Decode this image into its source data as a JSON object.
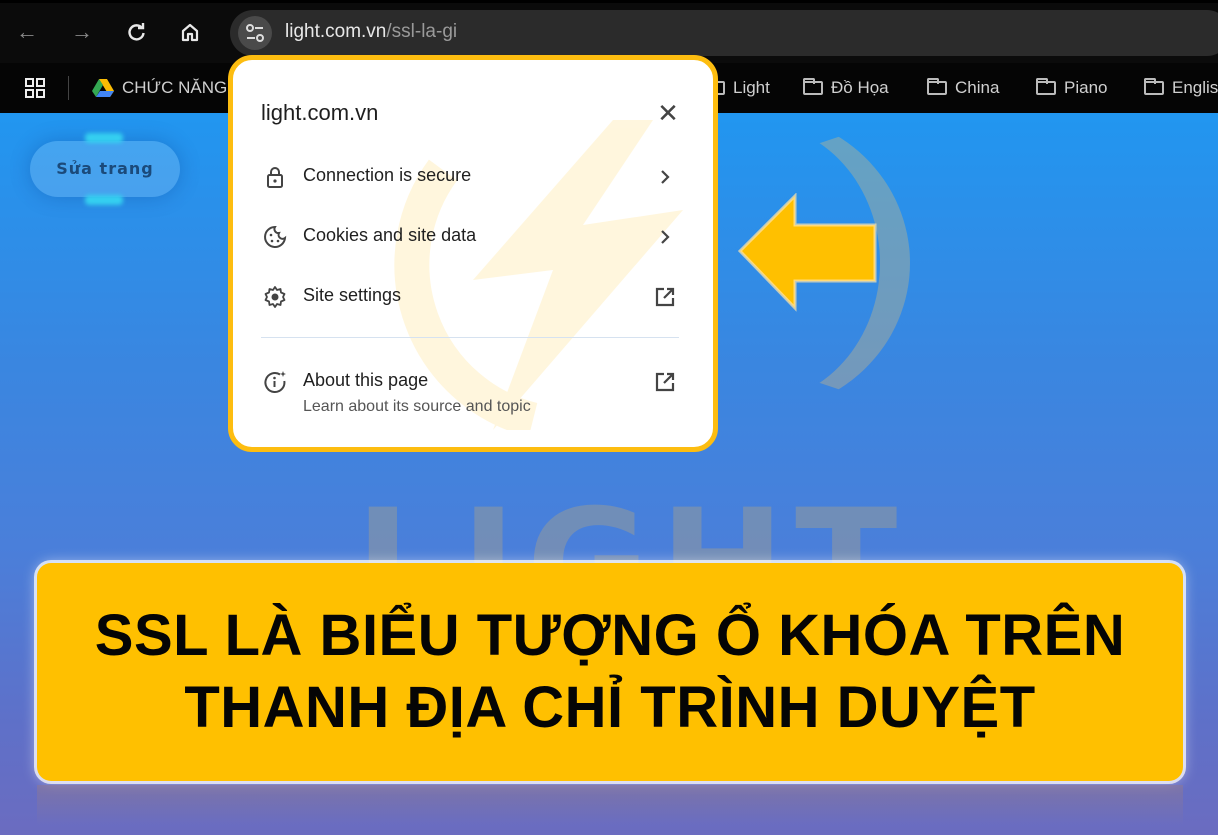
{
  "browser": {
    "nav": {
      "back_icon": "arrow-left-icon",
      "forward_icon": "arrow-right-icon",
      "reload_icon": "reload-icon",
      "home_icon": "home-icon"
    },
    "omnibox": {
      "site_info_icon": "tune-icon",
      "domain": "light.com.vn",
      "path": "/ssl-la-gi"
    },
    "bookmarks": [
      {
        "label": "CHỨC NĂNG",
        "icon": "google-drive-icon"
      },
      {
        "label": "Light",
        "icon": "folder-icon"
      },
      {
        "label": "Đồ Họa",
        "icon": "folder-icon"
      },
      {
        "label": "China",
        "icon": "folder-icon"
      },
      {
        "label": "Piano",
        "icon": "folder-icon"
      },
      {
        "label": "Englis",
        "icon": "folder-icon"
      }
    ],
    "apps_icon": "apps-grid-icon"
  },
  "page": {
    "edit_button": "Sửa trang",
    "watermark": "LIGHT",
    "arrow_color": "#ffc000"
  },
  "site_info_popup": {
    "title": "light.com.vn",
    "close_icon": "close-icon",
    "items": [
      {
        "label": "Connection is secure",
        "icon": "lock-icon",
        "trailing": "chevron-right-icon"
      },
      {
        "label": "Cookies and site data",
        "icon": "cookie-icon",
        "trailing": "chevron-right-icon"
      },
      {
        "label": "Site settings",
        "icon": "gear-icon",
        "trailing": "open-in-new-icon"
      },
      {
        "label": "About this page",
        "sublabel": "Learn about its source and topic",
        "icon": "info-sparkle-icon",
        "trailing": "open-in-new-icon"
      }
    ],
    "highlight_color": "#fdbd10"
  },
  "banner": {
    "line1": "SSL LÀ BIỂU TƯỢNG Ổ KHÓA TRÊN",
    "line2": "THANH ĐỊA CHỈ TRÌNH DUYỆT",
    "background": "#ffc000"
  }
}
